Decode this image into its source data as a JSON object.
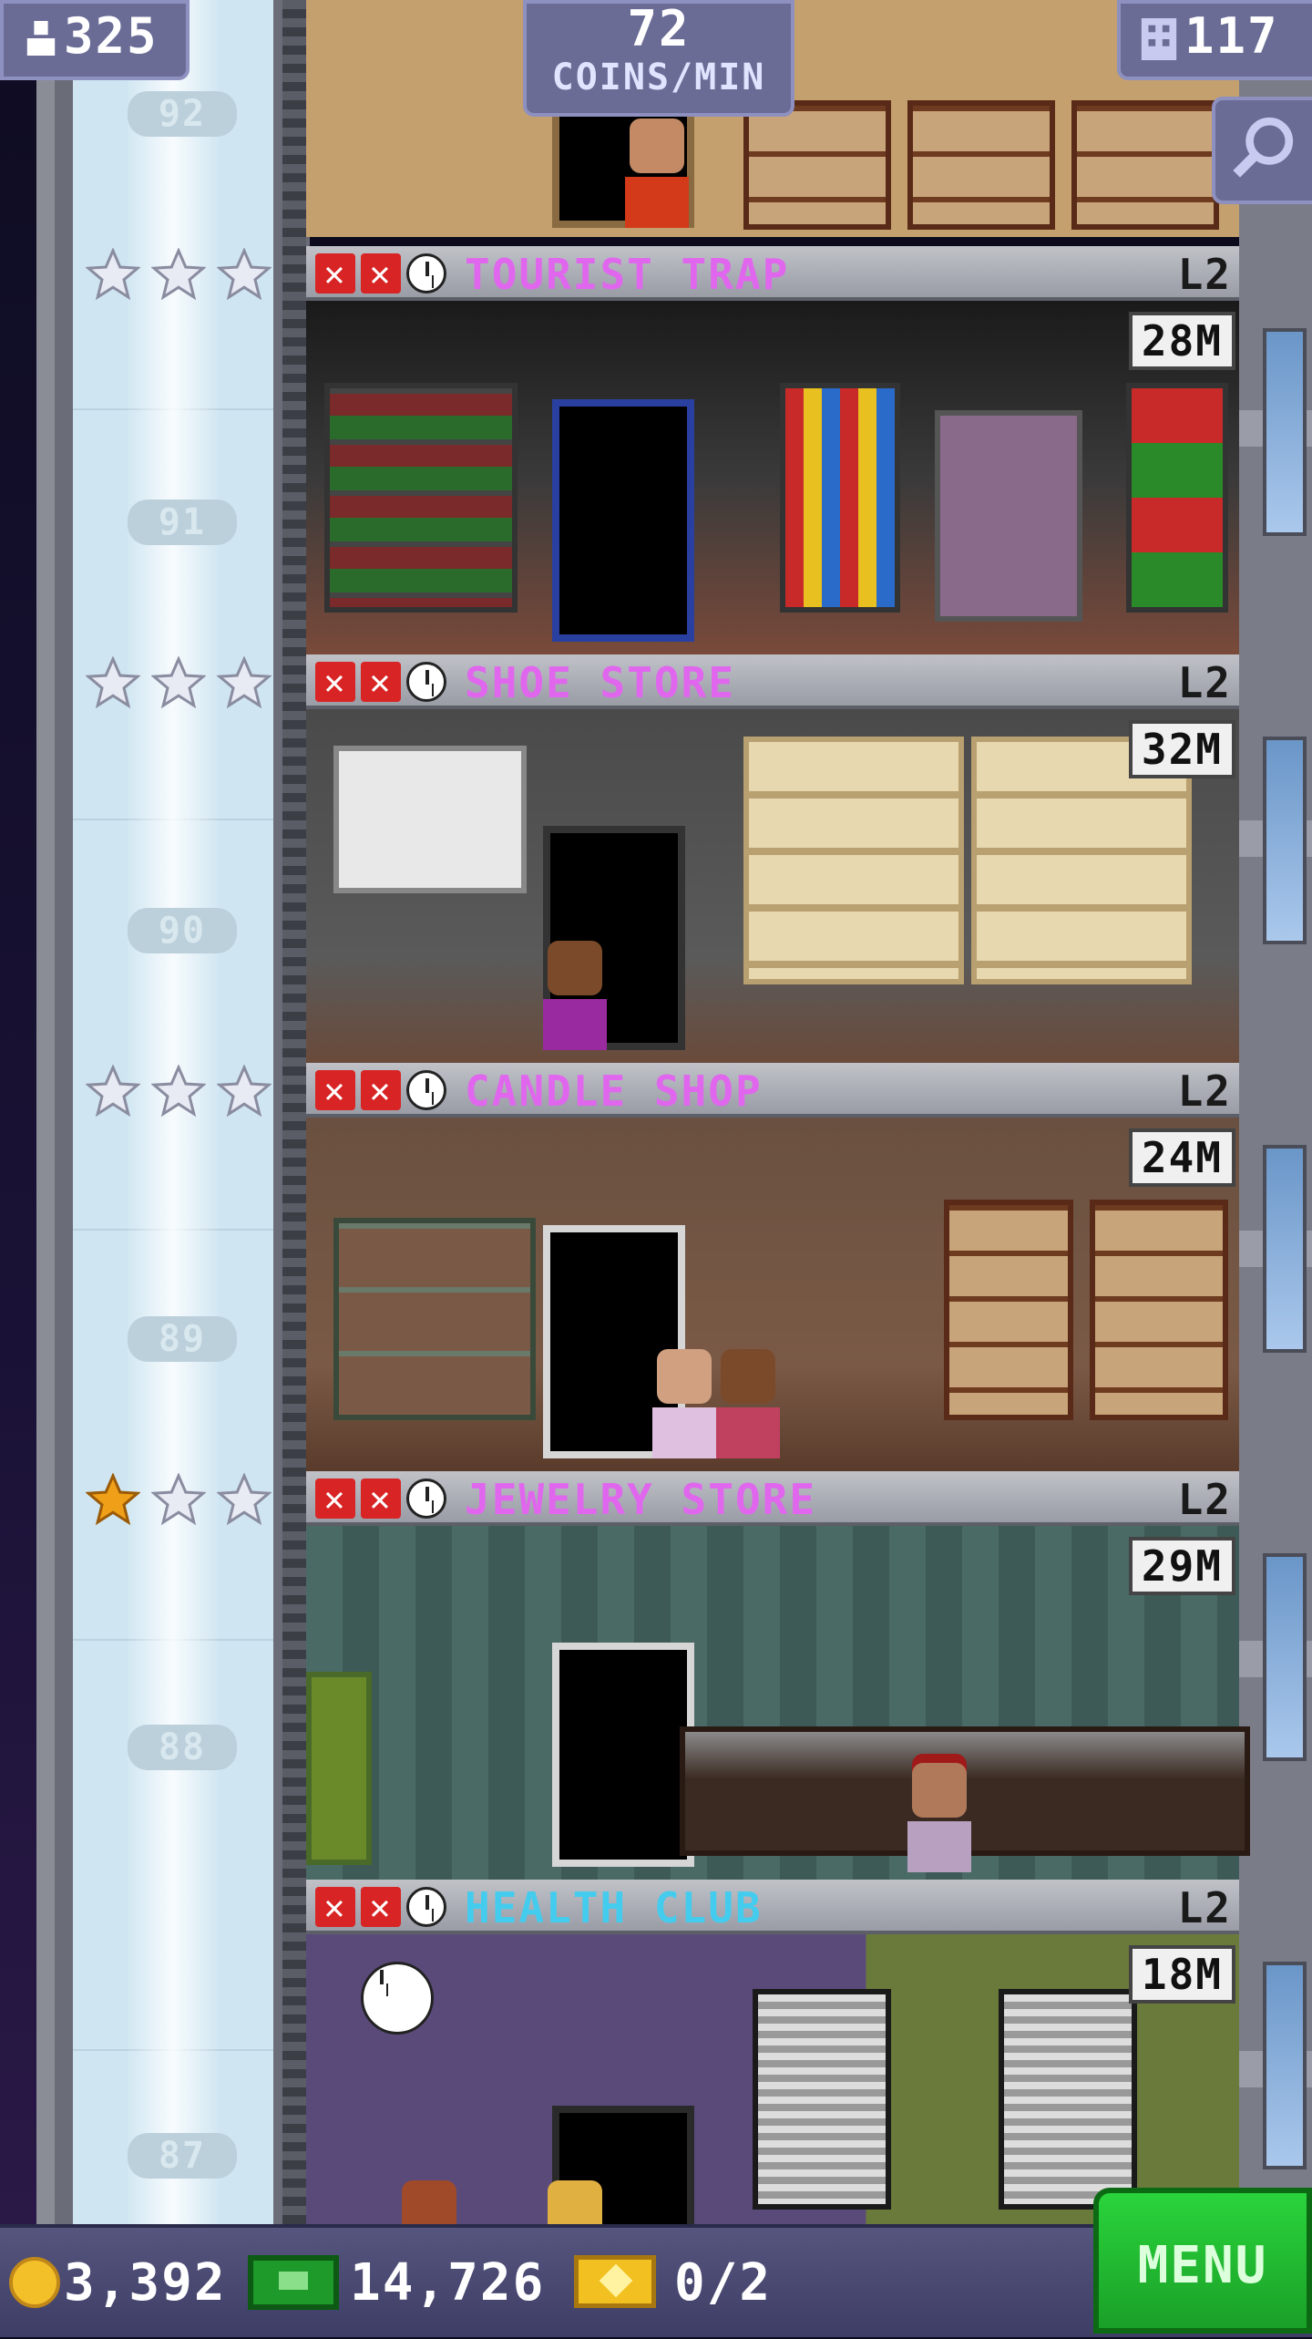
{
  "header": {
    "population": "325",
    "coins_per_min_value": "72",
    "coins_per_min_label": "COINS/MIN",
    "floors_count": "117"
  },
  "elevator": {
    "floor_numbers": [
      "92",
      "91",
      "90",
      "89",
      "88",
      "87"
    ]
  },
  "floors": [
    {
      "name": "TOURIST TRAP",
      "name_color": "#e066ee",
      "level": "L2",
      "stock": "28M",
      "stars_gold": 0
    },
    {
      "name": "SHOE STORE",
      "name_color": "#e066ee",
      "level": "L2",
      "stock": "32M",
      "stars_gold": 0
    },
    {
      "name": "CANDLE SHOP",
      "name_color": "#e066ee",
      "level": "L2",
      "stock": "24M",
      "stars_gold": 0
    },
    {
      "name": "JEWELRY STORE",
      "name_color": "#e066ee",
      "level": "L2",
      "stock": "29M",
      "stars_gold": 1
    },
    {
      "name": "HEALTH CLUB",
      "name_color": "#44ccee",
      "level": "L2",
      "stock": "18M",
      "stars_gold": 0
    }
  ],
  "bottom": {
    "coins": "3,392",
    "bux": "14,726",
    "tickets": "0/2",
    "menu_label": "MENU"
  },
  "icons": {
    "population": "person-icon",
    "floors": "building-icon",
    "search": "magnifier-icon",
    "coins": "coin-icon",
    "bux": "bux-icon",
    "tickets": "ticket-icon",
    "status_fail": "x-icon",
    "status_time": "clock-icon",
    "star": "star-icon"
  },
  "colors": {
    "menu_green": "#22c032",
    "star_silver": "#e8eaf4",
    "star_gold": "#f0a018"
  }
}
